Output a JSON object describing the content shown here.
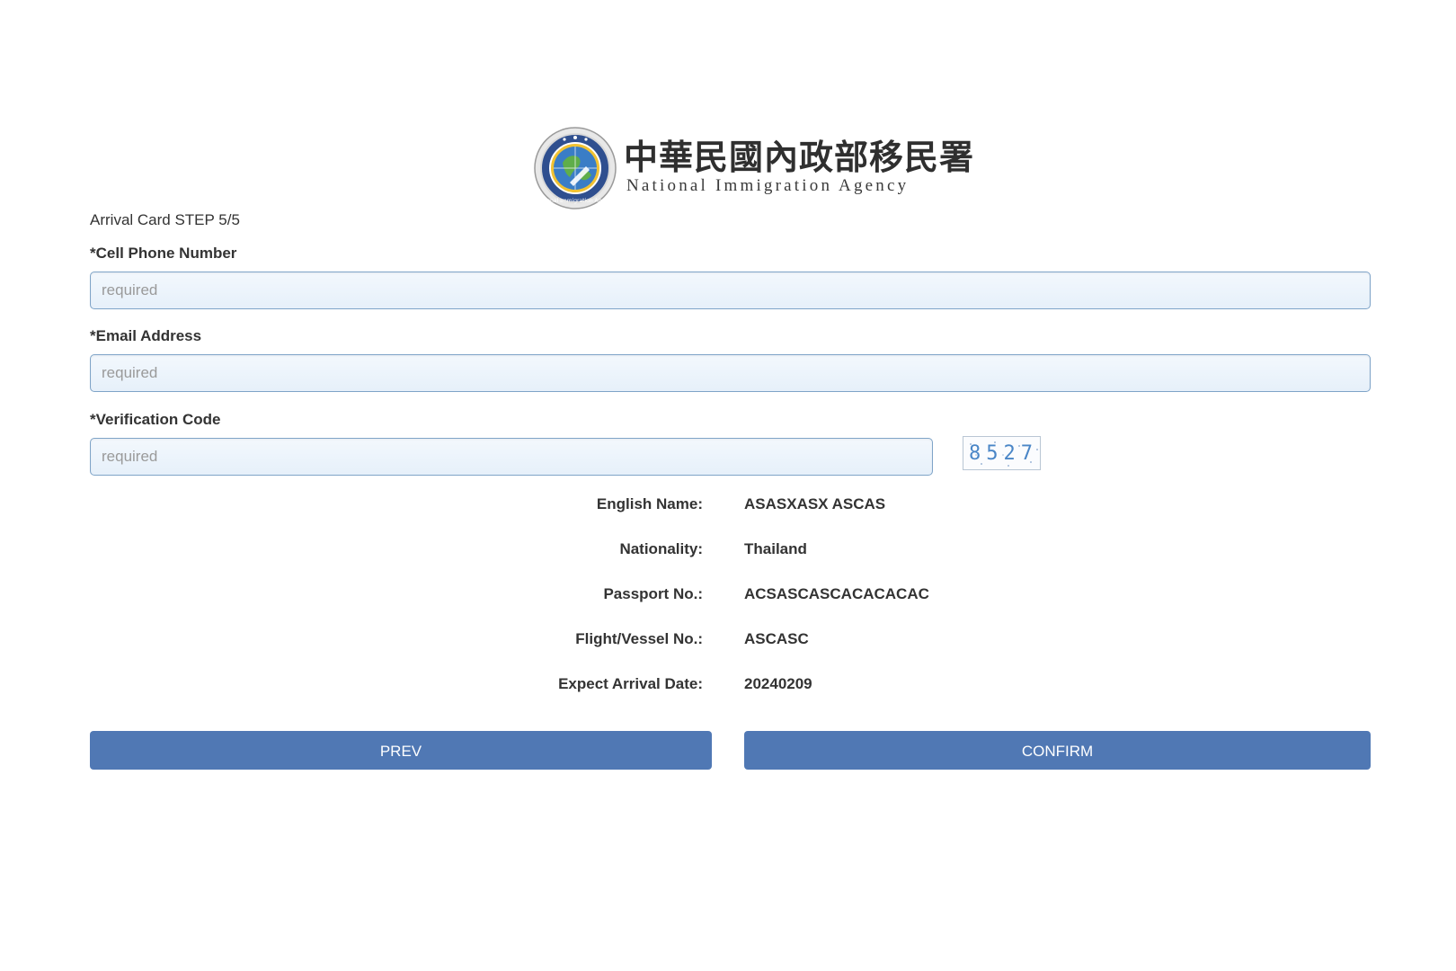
{
  "brand": {
    "name_zh": "中華民國內政部移民署",
    "name_en": "National Immigration Agency",
    "seal_ring_text": "National Immigration Agency"
  },
  "form": {
    "step_text": "Arrival Card STEP 5/5",
    "cell_phone": {
      "label": "*Cell Phone Number",
      "placeholder": "required",
      "value": ""
    },
    "email": {
      "label": "*Email Address",
      "placeholder": "required",
      "value": ""
    },
    "verification": {
      "label": "*Verification Code",
      "placeholder": "required",
      "value": ""
    },
    "captcha_code": "8527"
  },
  "summary": [
    {
      "key": "English Name:",
      "value": "ASASXASX ASCAS"
    },
    {
      "key": "Nationality:",
      "value": "Thailand"
    },
    {
      "key": "Passport No.:",
      "value": "ACSASCASCACACACAC"
    },
    {
      "key": "Flight/Vessel No.:",
      "value": "ASCASC"
    },
    {
      "key": "Expect Arrival Date:",
      "value": "20240209"
    }
  ],
  "buttons": {
    "prev": "PREV",
    "confirm": "CONFIRM"
  },
  "colors": {
    "button_bg": "#5078b4",
    "input_border": "#7fa4c8",
    "captcha_text": "#4a86c7"
  }
}
